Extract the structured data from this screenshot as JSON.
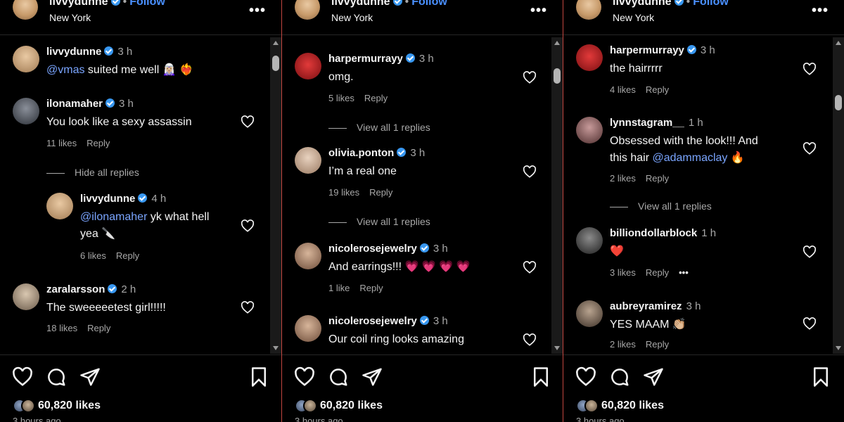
{
  "shared": {
    "follow_label": "Follow",
    "location": "New York",
    "more_label": "•••",
    "likes_count": "60,820 likes",
    "posted_ago": "3 hours ago",
    "dot": "•"
  },
  "panels": [
    {
      "header_user": "livvydunne",
      "comments": [
        {
          "user": "livvydunne",
          "time": "3 h",
          "mention": "@vmas",
          "text": " suited me well 🧝🏼‍♀️ ❤️‍🔥",
          "meta_likes": "",
          "reply": ""
        },
        {
          "user": "ilonamaher",
          "time": "3 h",
          "mention": "",
          "text": "You look like a sexy assassin",
          "meta_likes": "11 likes",
          "reply": "Reply"
        },
        {
          "user": "livvydunne",
          "time": "4 h",
          "mention": "@ilonamaher",
          "text": " yk what hell yea 🔪",
          "meta_likes": "6 likes",
          "reply": "Reply"
        },
        {
          "user": "zaralarsson",
          "time": "2 h",
          "mention": "",
          "text": "The sweeeeetest girl!!!!!",
          "meta_likes": "18 likes",
          "reply": "Reply"
        }
      ],
      "view_replies": [
        "Hide all replies"
      ]
    },
    {
      "header_user": "livvydunne",
      "comments": [
        {
          "user": "harpermurrayy",
          "time": "3 h",
          "mention": "",
          "text": "omg.",
          "meta_likes": "5 likes",
          "reply": "Reply"
        },
        {
          "user": "olivia.ponton",
          "time": "3 h",
          "mention": "",
          "text": "I’m a real one",
          "meta_likes": "19 likes",
          "reply": "Reply"
        },
        {
          "user": "nicolerosejewelry",
          "time": "3 h",
          "mention": "",
          "text": "And earrings!!! 💗 💗 💗 💗",
          "meta_likes": "1 like",
          "reply": "Reply"
        },
        {
          "user": "nicolerosejewelry",
          "time": "3 h",
          "mention": "",
          "text": "Our coil ring looks amazing",
          "meta_likes": "",
          "reply": ""
        }
      ],
      "view_replies": [
        "View all 1 replies",
        "View all 1 replies"
      ]
    },
    {
      "header_user": "livvydunne",
      "comments": [
        {
          "user": "harpermurrayy",
          "time": "3 h",
          "mention": "",
          "text": "the hairrrrr",
          "meta_likes": "4 likes",
          "reply": "Reply"
        },
        {
          "user": "lynnstagram__",
          "time": "1 h",
          "mention": "",
          "text": "Obsessed with the look!!! And",
          "text2_prefix": "this hair ",
          "mention2": "@adammaclay",
          "text2_suffix": " 🔥",
          "meta_likes": "2 likes",
          "reply": "Reply"
        },
        {
          "user": "billiondollarblock",
          "time": "1 h",
          "mention": "",
          "text": "❤️",
          "meta_likes": "3 likes",
          "reply": "Reply",
          "more": "•••"
        },
        {
          "user": "aubreyramirez",
          "time": "3 h",
          "mention": "",
          "text": "YES MAAM 👏🏼",
          "meta_likes": "2 likes",
          "reply": "Reply"
        }
      ],
      "view_replies": [
        "View all 1 replies"
      ]
    }
  ]
}
